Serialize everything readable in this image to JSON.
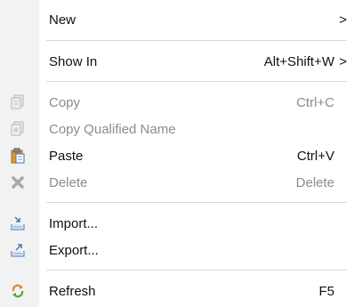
{
  "menu": {
    "items": [
      {
        "label": "New",
        "shortcut": "",
        "submenu": true,
        "enabled": true,
        "icon": ""
      },
      {
        "label": "Show In",
        "shortcut": "Alt+Shift+W",
        "submenu": true,
        "enabled": true,
        "icon": ""
      },
      {
        "label": "Copy",
        "shortcut": "Ctrl+C",
        "submenu": false,
        "enabled": false,
        "icon": "copy-icon"
      },
      {
        "label": "Copy Qualified Name",
        "shortcut": "",
        "submenu": false,
        "enabled": false,
        "icon": "copy-qualified-name-icon"
      },
      {
        "label": "Paste",
        "shortcut": "Ctrl+V",
        "submenu": false,
        "enabled": true,
        "icon": "paste-icon"
      },
      {
        "label": "Delete",
        "shortcut": "Delete",
        "submenu": false,
        "enabled": false,
        "icon": "delete-icon"
      },
      {
        "label": "Import...",
        "shortcut": "",
        "submenu": false,
        "enabled": true,
        "icon": "import-icon"
      },
      {
        "label": "Export...",
        "shortcut": "",
        "submenu": false,
        "enabled": true,
        "icon": "export-icon"
      },
      {
        "label": "Refresh",
        "shortcut": "F5",
        "submenu": false,
        "enabled": true,
        "icon": "refresh-icon"
      }
    ],
    "submenu_arrow": ">"
  }
}
